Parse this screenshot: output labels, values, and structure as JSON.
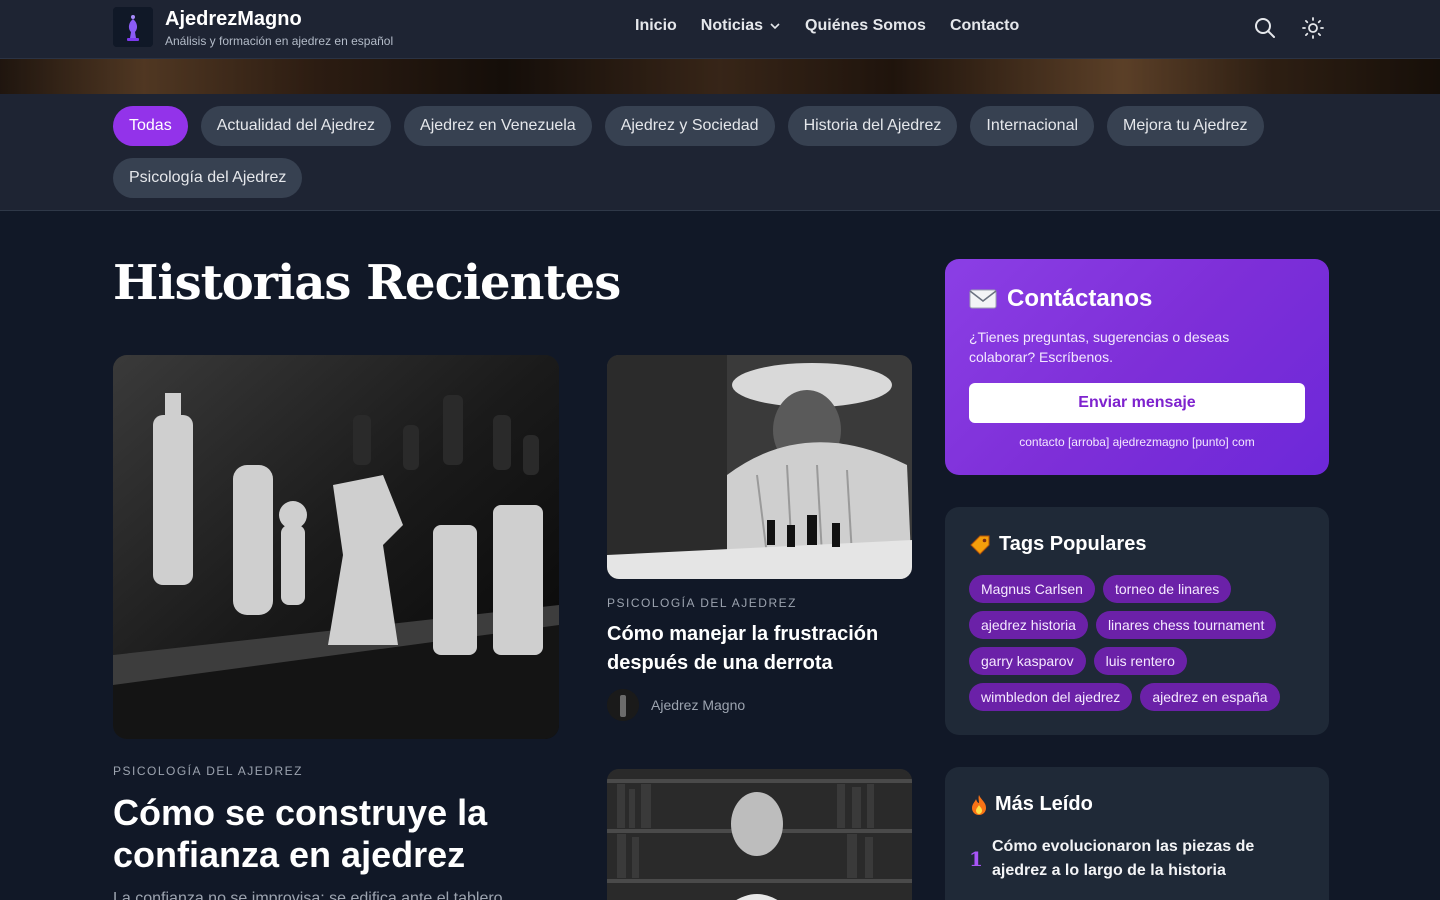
{
  "header": {
    "site_title": "AjedrezMagno",
    "tagline": "Análisis y formación en ajedrez en español",
    "nav": [
      "Inicio",
      "Noticias",
      "Quiénes Somos",
      "Contacto"
    ]
  },
  "categories": [
    "Todas",
    "Actualidad del Ajedrez",
    "Ajedrez en Venezuela",
    "Ajedrez y Sociedad",
    "Historia del Ajedrez",
    "Internacional",
    "Mejora tu Ajedrez",
    "Psicología del Ajedrez"
  ],
  "main": {
    "section_title": "Historias Recientes",
    "featured": {
      "category": "PSICOLOGÍA DEL AJEDREZ",
      "title": "Cómo se construye la confianza en ajedrez",
      "excerpt": "La confianza no se improvisa: se edifica ante el tablero..."
    },
    "card": {
      "category": "PSICOLOGÍA DEL AJEDREZ",
      "title": "Cómo manejar la frustración después de una derrota",
      "author": "Ajedrez Magno"
    }
  },
  "sidebar": {
    "contact": {
      "title": "Contáctanos",
      "text": "¿Tienes preguntas, sugerencias o deseas colaborar? Escríbenos.",
      "button": "Enviar mensaje",
      "email": "contacto [arroba] ajedrezmagno [punto] com"
    },
    "tags": {
      "title": "Tags Populares",
      "items": [
        "Magnus Carlsen",
        "torneo de linares",
        "ajedrez historia",
        "linares chess tournament",
        "garry kasparov",
        "luis rentero",
        "wimbledon del ajedrez",
        "ajedrez en españa"
      ]
    },
    "most_read": {
      "title": "Más Leído",
      "items": [
        {
          "num": "1",
          "title": "Cómo evolucionaron las piezas de ajedrez a lo largo de la historia"
        }
      ]
    }
  },
  "colors": {
    "accent": "#9333ea",
    "bg": "#111827",
    "panel": "#1f2937"
  }
}
